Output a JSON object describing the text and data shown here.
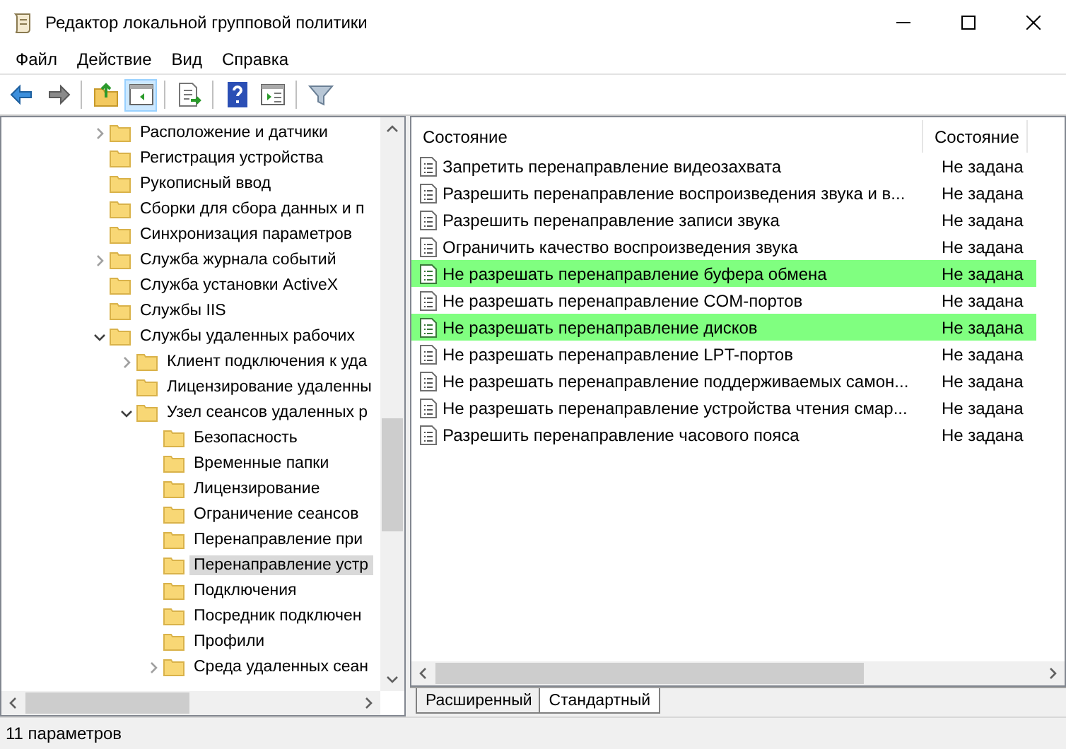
{
  "window": {
    "title": "Редактор локальной групповой политики"
  },
  "menu": [
    "Файл",
    "Действие",
    "Вид",
    "Справка"
  ],
  "toolbar": [
    {
      "kind": "back",
      "pressed": false
    },
    {
      "kind": "forward",
      "pressed": false
    },
    {
      "kind": "sep"
    },
    {
      "kind": "up",
      "pressed": false
    },
    {
      "kind": "tree",
      "pressed": true
    },
    {
      "kind": "sep"
    },
    {
      "kind": "export",
      "pressed": false
    },
    {
      "kind": "sep"
    },
    {
      "kind": "help",
      "pressed": false
    },
    {
      "kind": "props",
      "pressed": false
    },
    {
      "kind": "sep"
    },
    {
      "kind": "filter",
      "pressed": false
    }
  ],
  "tree": [
    {
      "label": "Расположение и датчики",
      "expandable": true,
      "expanded": false,
      "selected": false
    },
    {
      "label": "Регистрация устройства",
      "expandable": false,
      "selected": false
    },
    {
      "label": "Рукописный ввод",
      "expandable": false,
      "selected": false
    },
    {
      "label": "Сборки для сбора данных и п",
      "expandable": false,
      "selected": false
    },
    {
      "label": "Синхронизация параметров",
      "expandable": false,
      "selected": false
    },
    {
      "label": "Служба журнала событий",
      "expandable": true,
      "expanded": false,
      "selected": false
    },
    {
      "label": "Служба установки ActiveX",
      "expandable": false,
      "selected": false
    },
    {
      "label": "Службы IIS",
      "expandable": false,
      "selected": false
    },
    {
      "label": "Службы удаленных рабочих",
      "expandable": true,
      "expanded": true,
      "selected": false,
      "children": [
        {
          "label": "Клиент подключения к уда",
          "expandable": true,
          "expanded": false,
          "selected": false
        },
        {
          "label": "Лицензирование удаленны",
          "expandable": false,
          "selected": false
        },
        {
          "label": "Узел сеансов удаленных р",
          "expandable": true,
          "expanded": true,
          "selected": false,
          "children": [
            {
              "label": "Безопасность",
              "expandable": false,
              "selected": false
            },
            {
              "label": "Временные папки",
              "expandable": false,
              "selected": false
            },
            {
              "label": "Лицензирование",
              "expandable": false,
              "selected": false
            },
            {
              "label": "Ограничение сеансов",
              "expandable": false,
              "selected": false
            },
            {
              "label": "Перенаправление при",
              "expandable": false,
              "selected": false
            },
            {
              "label": "Перенаправление устр",
              "expandable": false,
              "selected": true
            },
            {
              "label": "Подключения",
              "expandable": false,
              "selected": false
            },
            {
              "label": "Посредник подключен",
              "expandable": false,
              "selected": false
            },
            {
              "label": "Профили",
              "expandable": false,
              "selected": false
            },
            {
              "label": "Среда удаленных сеан",
              "expandable": true,
              "expanded": false,
              "selected": false
            }
          ]
        }
      ]
    }
  ],
  "list": {
    "columns": [
      "Состояние",
      "Состояние"
    ],
    "rows": [
      {
        "name": "Запретить перенаправление видеозахвата",
        "state": "Не задана",
        "highlighted": false
      },
      {
        "name": "Разрешить перенаправление воспроизведения звука и в...",
        "state": "Не задана",
        "highlighted": false
      },
      {
        "name": "Разрешить перенаправление записи звука",
        "state": "Не задана",
        "highlighted": false
      },
      {
        "name": "Ограничить качество воспроизведения звука",
        "state": "Не задана",
        "highlighted": false
      },
      {
        "name": "Не разрешать перенаправление буфера обмена",
        "state": "Не задана",
        "highlighted": true
      },
      {
        "name": "Не разрешать перенаправление COM-портов",
        "state": "Не задана",
        "highlighted": false
      },
      {
        "name": "Не разрешать перенаправление дисков",
        "state": "Не задана",
        "highlighted": true
      },
      {
        "name": "Не разрешать перенаправление LPT-портов",
        "state": "Не задана",
        "highlighted": false
      },
      {
        "name": "Не разрешать перенаправление поддерживаемых самон...",
        "state": "Не задана",
        "highlighted": false
      },
      {
        "name": "Не разрешать перенаправление устройства чтения смар...",
        "state": "Не задана",
        "highlighted": false
      },
      {
        "name": "Разрешить перенаправление часового пояса",
        "state": "Не задана",
        "highlighted": false
      }
    ]
  },
  "view_tabs": [
    {
      "label": "Расширенный",
      "selected": false
    },
    {
      "label": "Стандартный",
      "selected": true
    }
  ],
  "status_bar": "11 параметров"
}
